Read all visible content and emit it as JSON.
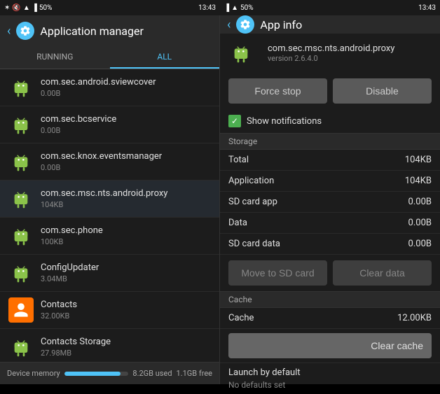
{
  "statusBar": {
    "leftIcons": [
      "BT",
      "mute",
      "wifi",
      "signal",
      "50%"
    ],
    "time": "13:43",
    "rightIcons": [
      "battery"
    ]
  },
  "leftPanel": {
    "title": "Application manager",
    "tabs": [
      {
        "label": "RUNNING",
        "active": false
      },
      {
        "label": "ALL",
        "active": true
      }
    ],
    "apps": [
      {
        "name": "com.sec.android.sviewcover",
        "size": "0.00B"
      },
      {
        "name": "com.sec.bcservice",
        "size": "0.00B"
      },
      {
        "name": "com.sec.knox.eventsmanager",
        "size": "0.00B"
      },
      {
        "name": "com.sec.msc.nts.android.proxy",
        "size": "104KB"
      },
      {
        "name": "com.sec.phone",
        "size": "100KB"
      },
      {
        "name": "ConfigUpdater",
        "size": "3.04MB"
      },
      {
        "name": "Contacts",
        "size": "32.00KB",
        "type": "contact"
      },
      {
        "name": "Contacts Storage",
        "size": "27.98MB"
      }
    ],
    "deviceMemory": "Device memory",
    "usedStorage": "8.2GB used",
    "freeStorage": "1.1GB free",
    "progressPercent": 88
  },
  "rightPanel": {
    "title": "App info",
    "appPackage": "com.sec.msc.nts.android.proxy",
    "appVersion": "version 2.6.4.0",
    "buttons": {
      "forceStop": "Force stop",
      "disable": "Disable"
    },
    "showNotifications": "Show notifications",
    "storage": {
      "sectionLabel": "Storage",
      "rows": [
        {
          "label": "Total",
          "value": "104KB"
        },
        {
          "label": "Application",
          "value": "104KB"
        },
        {
          "label": "SD card app",
          "value": "0.00B"
        },
        {
          "label": "Data",
          "value": "0.00B"
        },
        {
          "label": "SD card data",
          "value": "0.00B"
        }
      ],
      "moveToSD": "Move to SD card",
      "clearData": "Clear data"
    },
    "cache": {
      "sectionLabel": "Cache",
      "cacheLabel": "Cache",
      "cacheValue": "12.00KB",
      "clearCache": "Clear cache"
    },
    "launchByDefault": "Launch by default",
    "noDefaults": "No defaults set"
  }
}
